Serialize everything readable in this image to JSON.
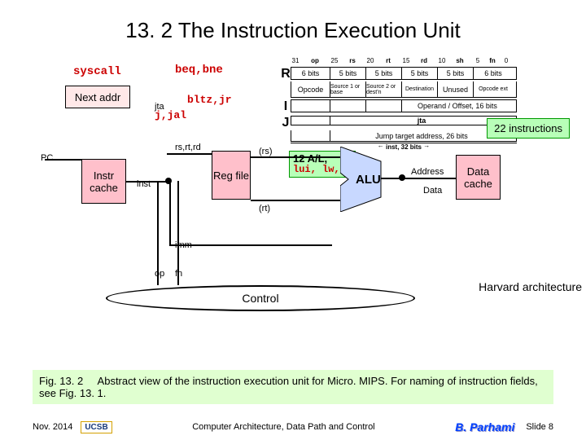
{
  "title": "13. 2  The Instruction Execution Unit",
  "labels": {
    "syscall": "syscall",
    "beq_bne": "beq,bne",
    "next_addr": "Next addr",
    "bltz_jr": "bltz,jr",
    "j_jal": "j,jal",
    "jta_small": "jta",
    "instr_count": "22 instructions",
    "pc": "PC",
    "instr_cache": "Instr cache",
    "inst": "inst",
    "rs_rt_rd": "rs,rt,rd",
    "reg_file": "Reg file",
    "rs_out": "(rs)",
    "rt_out": "(rt)",
    "twelve_al": "12 A/L,",
    "lui_lw_sw": "lui, lw,sw",
    "alu": "ALU",
    "address": "Address",
    "data": "Data",
    "data_cache": "Data cache",
    "imm": "imm",
    "op": "op",
    "fn": "fn",
    "control": "Control",
    "harvard": "Harvard architecture"
  },
  "encoding": {
    "bits_header": [
      "31",
      "op",
      "25",
      "rs",
      "20",
      "rt",
      "15",
      "rd",
      "10",
      "sh",
      "5",
      "fn",
      "0"
    ],
    "widths": [
      "6 bits",
      "5 bits",
      "5 bits",
      "5 bits",
      "5 bits",
      "6 bits"
    ],
    "R": {
      "cells": [
        "Opcode",
        "Source 1 or base",
        "Source 2 or dest'n",
        "Destination",
        "Unused",
        "Opcode ext"
      ]
    },
    "I": {
      "cells": [
        "",
        "",
        "",
        "Operand / Offset, 16 bits"
      ]
    },
    "J_top": "jta",
    "J_bottom": "Jump target address, 26 bits",
    "inst_label": "inst, 32 bits"
  },
  "caption": {
    "fignum": "Fig. 13. 2",
    "text": "Abstract view of the instruction execution unit for Micro. MIPS. For naming of instruction fields, see Fig. 13. 1."
  },
  "footer": {
    "date": "Nov. 2014",
    "org": "UCSB",
    "center": "Computer Architecture, Data Path and Control",
    "author": "B. Parhami",
    "slide": "Slide 8"
  }
}
